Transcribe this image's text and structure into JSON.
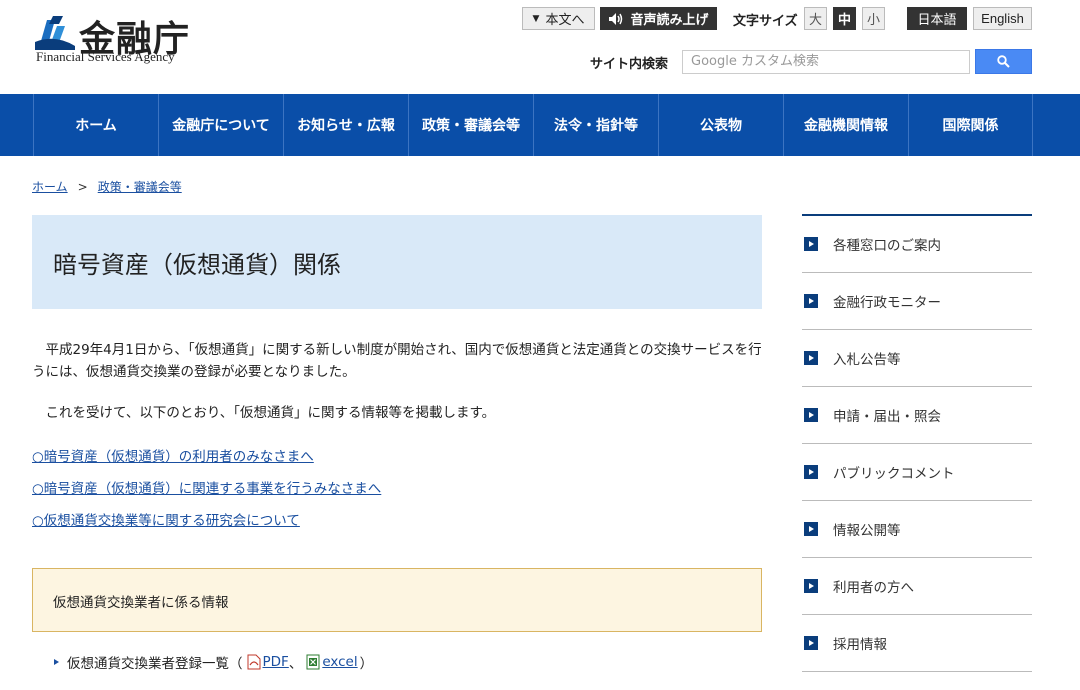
{
  "header": {
    "logo_text": "金融庁",
    "logo_sub": "Financial Services Agency",
    "skip_label": "本文へ",
    "voice_label": "音声読み上げ",
    "font_size_label": "文字サイズ",
    "font_sizes": [
      "大",
      "中",
      "小"
    ],
    "lang_ja": "日本語",
    "lang_en": "English",
    "search_label": "サイト内検索",
    "search_placeholder": "Google カスタム検索"
  },
  "nav": {
    "items": [
      "ホーム",
      "金融庁について",
      "お知らせ・広報",
      "政策・審議会等",
      "法令・指針等",
      "公表物",
      "金融機関情報",
      "国際関係"
    ]
  },
  "breadcrumb": {
    "home": "ホーム",
    "separator": ">",
    "current": "政策・審議会等"
  },
  "main": {
    "title": "暗号資産（仮想通貨）関係",
    "para1": "　平成29年4月1日から、「仮想通貨」に関する新しい制度が開始され、国内で仮想通貨と法定通貨との交換サービスを行うには、仮想通貨交換業の登録が必要となりました。",
    "para2": "　これを受けて、以下のとおり、「仮想通貨」に関する情報等を掲載します。",
    "links": [
      "○暗号資産（仮想通貨）の利用者のみなさまへ",
      "○暗号資産（仮想通貨）に関連する事業を行うみなさまへ",
      "○仮想通貨交換業等に関する研究会について"
    ],
    "info_box_title": "仮想通貨交換業者に係る情報",
    "registry_label": "仮想通貨交換業者登録一覧（",
    "pdf_label": "PDF",
    "comma": "、",
    "excel_label": "excel",
    "close_paren": "）"
  },
  "sidebar": {
    "items": [
      "各種窓口のご案内",
      "金融行政モニター",
      "入札公告等",
      "申請・届出・照会",
      "パブリックコメント",
      "情報公開等",
      "利用者の方へ",
      "採用情報"
    ]
  },
  "colors": {
    "nav_bg": "#0a4ea8",
    "title_bg": "#d9e9f8",
    "info_bg": "#fdf5e1",
    "link": "#1a4fa0"
  }
}
